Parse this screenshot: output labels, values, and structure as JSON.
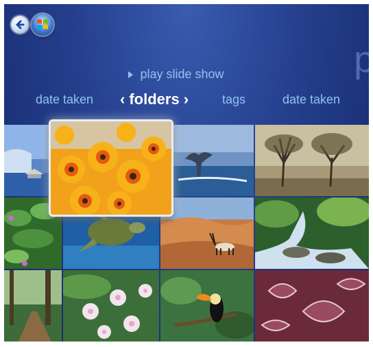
{
  "nav": {
    "back_icon": "back-arrow-icon",
    "start_icon": "windows-orb-icon"
  },
  "header": {
    "title_partial": "p"
  },
  "slideshow": {
    "label": "play slide show",
    "icon": "play-icon"
  },
  "pivots": {
    "left_partial": "date taken",
    "active": "folders",
    "next": "tags",
    "right_partial": "date taken"
  },
  "photos": [
    {
      "name": "beach-resort"
    },
    {
      "name": "orange-flowers",
      "selected": true
    },
    {
      "name": "whale-tail"
    },
    {
      "name": "bare-trees"
    },
    {
      "name": "green-plants"
    },
    {
      "name": "sea-turtle"
    },
    {
      "name": "desert-oryx"
    },
    {
      "name": "waterfall-creek"
    },
    {
      "name": "forest-path"
    },
    {
      "name": "white-flowers"
    },
    {
      "name": "toucan"
    },
    {
      "name": "frosted-leaves"
    }
  ]
}
